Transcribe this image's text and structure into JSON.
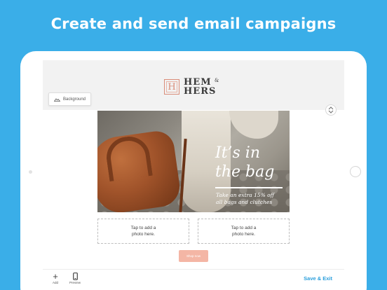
{
  "headline": "Create and send email campaigns",
  "email": {
    "brand_line1": "HEM",
    "brand_amp": "&",
    "brand_line2": "HERS",
    "brand_mark": "H",
    "background_button": "Background",
    "hero_title_line1": "It’s in",
    "hero_title_line2": "the bag",
    "hero_sub_line1": "Take an extra 15% off",
    "hero_sub_line2": "all bags and clutches",
    "photo_slot_left": {
      "line1": "Tap to add a",
      "line2": "photo here."
    },
    "photo_slot_right": {
      "line1": "Tap to add a",
      "line2": "photo here."
    },
    "shop_button": "Shop now"
  },
  "toolbar": {
    "add_label": "Add",
    "add_icon": "plus-icon",
    "preview_label": "Preview",
    "preview_icon": "phone-icon",
    "save_exit": "Save & Exit"
  },
  "colors": {
    "page_background": "#3aaee8",
    "accent": "#2b9fdc",
    "shop_button": "#f4b6a5",
    "brand_mark": "#d98c78"
  }
}
